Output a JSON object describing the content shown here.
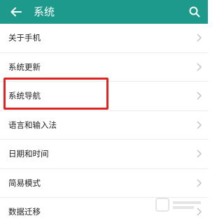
{
  "header": {
    "title": "系统",
    "background": "#1d9a8c",
    "back_icon": "arrow-left-icon",
    "search_icon": "search-icon"
  },
  "menu": {
    "items": [
      {
        "label": "关于手机"
      },
      {
        "label": "系统更新"
      },
      {
        "label": "系统导航"
      },
      {
        "label": "语言和输入法"
      },
      {
        "label": "日期和时间"
      },
      {
        "label": "简易模式"
      },
      {
        "label": "数据迁移"
      }
    ]
  },
  "highlight": {
    "color": "#e02424",
    "target": "系统导航"
  }
}
